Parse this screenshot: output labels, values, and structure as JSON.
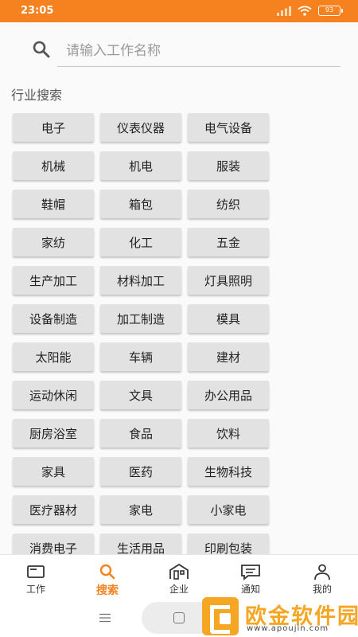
{
  "status_bar": {
    "time": "23:05",
    "battery": "93"
  },
  "search": {
    "placeholder": "请输入工作名称",
    "value": ""
  },
  "section": {
    "title": "行业搜索"
  },
  "industries": [
    "电子",
    "仪表仪器",
    "电气设备",
    "机械",
    "机电",
    "服装",
    "鞋帽",
    "箱包",
    "纺织",
    "家纺",
    "化工",
    "五金",
    "生产加工",
    "材料加工",
    "灯具照明",
    "设备制造",
    "加工制造",
    "模具",
    "太阳能",
    "车辆",
    "建材",
    "运动休闲",
    "文具",
    "办公用品",
    "厨房浴室",
    "食品",
    "饮料",
    "家具",
    "医药",
    "生物科技",
    "医疗器材",
    "家电",
    "小家电",
    "消费电子",
    "生活用品",
    "印刷包装"
  ],
  "tabbar": {
    "items": [
      {
        "label": "工作",
        "icon": "briefcase-icon",
        "active": false
      },
      {
        "label": "搜索",
        "icon": "search-icon",
        "active": true
      },
      {
        "label": "企业",
        "icon": "building-icon",
        "active": false
      },
      {
        "label": "通知",
        "icon": "message-icon",
        "active": false
      },
      {
        "label": "我的",
        "icon": "person-icon",
        "active": false
      }
    ]
  },
  "watermark": {
    "title": "欧金软件园",
    "url": "www.apoujin.com"
  },
  "colors": {
    "accent": "#f5821f",
    "tag_bg": "#e2e2e2",
    "watermark": "#f5a623"
  }
}
